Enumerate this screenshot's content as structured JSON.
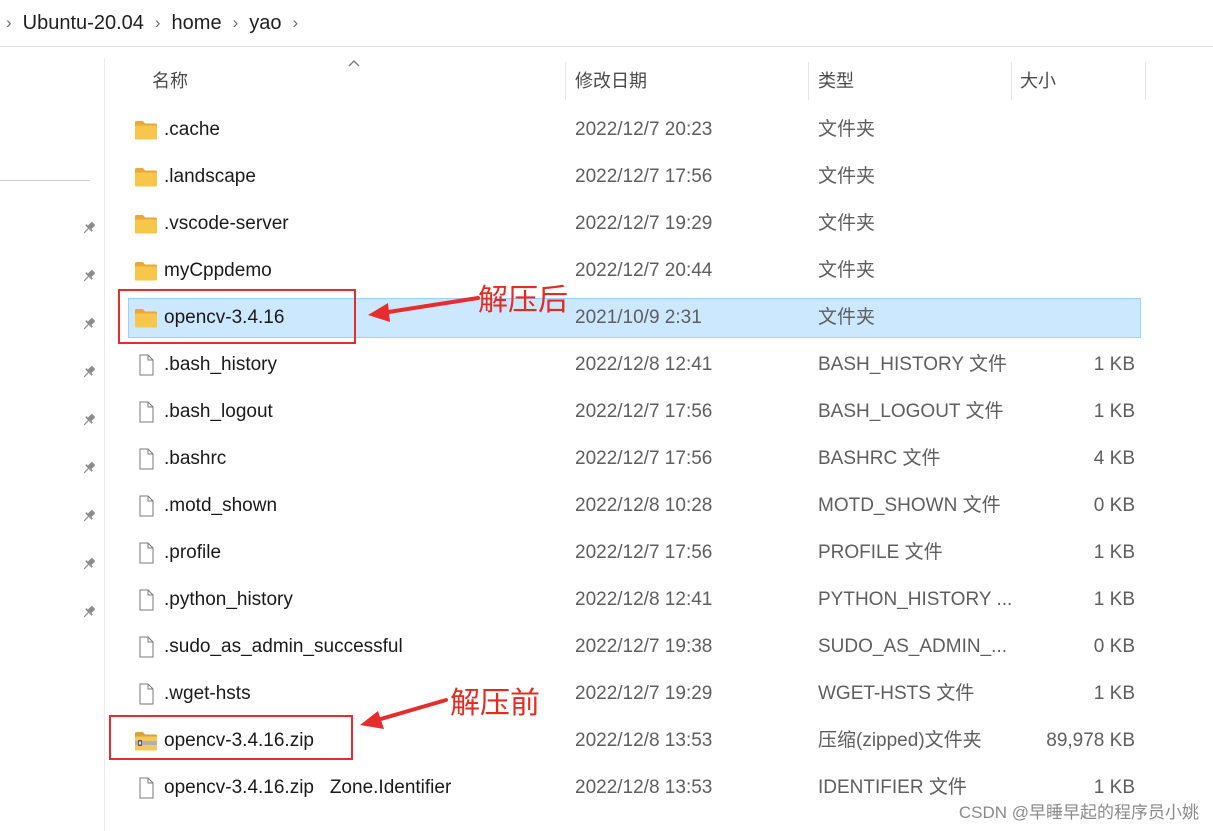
{
  "breadcrumb": [
    "Ubuntu-20.04",
    "home",
    "yao"
  ],
  "columns": {
    "name": "名称",
    "modified": "修改日期",
    "type": "类型",
    "size": "大小"
  },
  "files": [
    {
      "name": ".cache",
      "modified": "2022/12/7 20:23",
      "type": "文件夹",
      "size": "",
      "icon": "folder-icon",
      "selected": false
    },
    {
      "name": ".landscape",
      "modified": "2022/12/7 17:56",
      "type": "文件夹",
      "size": "",
      "icon": "folder-icon",
      "selected": false
    },
    {
      "name": ".vscode-server",
      "modified": "2022/12/7 19:29",
      "type": "文件夹",
      "size": "",
      "icon": "folder-icon",
      "selected": false
    },
    {
      "name": "myCppdemo",
      "modified": "2022/12/7 20:44",
      "type": "文件夹",
      "size": "",
      "icon": "folder-icon",
      "selected": false
    },
    {
      "name": "opencv-3.4.16",
      "modified": "2021/10/9 2:31",
      "type": "文件夹",
      "size": "",
      "icon": "folder-icon",
      "selected": true
    },
    {
      "name": ".bash_history",
      "modified": "2022/12/8 12:41",
      "type": "BASH_HISTORY 文件",
      "size": "1 KB",
      "icon": "file-icon",
      "selected": false
    },
    {
      "name": ".bash_logout",
      "modified": "2022/12/7 17:56",
      "type": "BASH_LOGOUT 文件",
      "size": "1 KB",
      "icon": "file-icon",
      "selected": false
    },
    {
      "name": ".bashrc",
      "modified": "2022/12/7 17:56",
      "type": "BASHRC 文件",
      "size": "4 KB",
      "icon": "file-icon",
      "selected": false
    },
    {
      "name": ".motd_shown",
      "modified": "2022/12/8 10:28",
      "type": "MOTD_SHOWN 文件",
      "size": "0 KB",
      "icon": "file-icon",
      "selected": false
    },
    {
      "name": ".profile",
      "modified": "2022/12/7 17:56",
      "type": "PROFILE 文件",
      "size": "1 KB",
      "icon": "file-icon",
      "selected": false
    },
    {
      "name": ".python_history",
      "modified": "2022/12/8 12:41",
      "type": "PYTHON_HISTORY ...",
      "size": "1 KB",
      "icon": "file-icon",
      "selected": false
    },
    {
      "name": ".sudo_as_admin_successful",
      "modified": "2022/12/7 19:38",
      "type": "SUDO_AS_ADMIN_...",
      "size": "0 KB",
      "icon": "file-icon",
      "selected": false
    },
    {
      "name": ".wget-hsts",
      "modified": "2022/12/7 19:29",
      "type": "WGET-HSTS 文件",
      "size": "1 KB",
      "icon": "file-icon",
      "selected": false
    },
    {
      "name": "opencv-3.4.16.zip",
      "modified": "2022/12/8 13:53",
      "type": "压缩(zipped)文件夹",
      "size": "89,978 KB",
      "icon": "zip-folder-icon",
      "selected": false
    },
    {
      "name": "opencv-3.4.16.zip   Zone.Identifier",
      "modified": "2022/12/8 13:53",
      "type": "IDENTIFIER 文件",
      "size": "1 KB",
      "icon": "file-icon",
      "selected": false
    }
  ],
  "annotations": {
    "after": "解压后",
    "before": "解压前"
  },
  "watermark": "CSDN @早睡早起的程序员小姚",
  "colors": {
    "selection": "#cce8ff",
    "selection_border": "#99d1ff",
    "annotation_red": "#e62c2c",
    "folder_yellow": "#f8c64a"
  }
}
